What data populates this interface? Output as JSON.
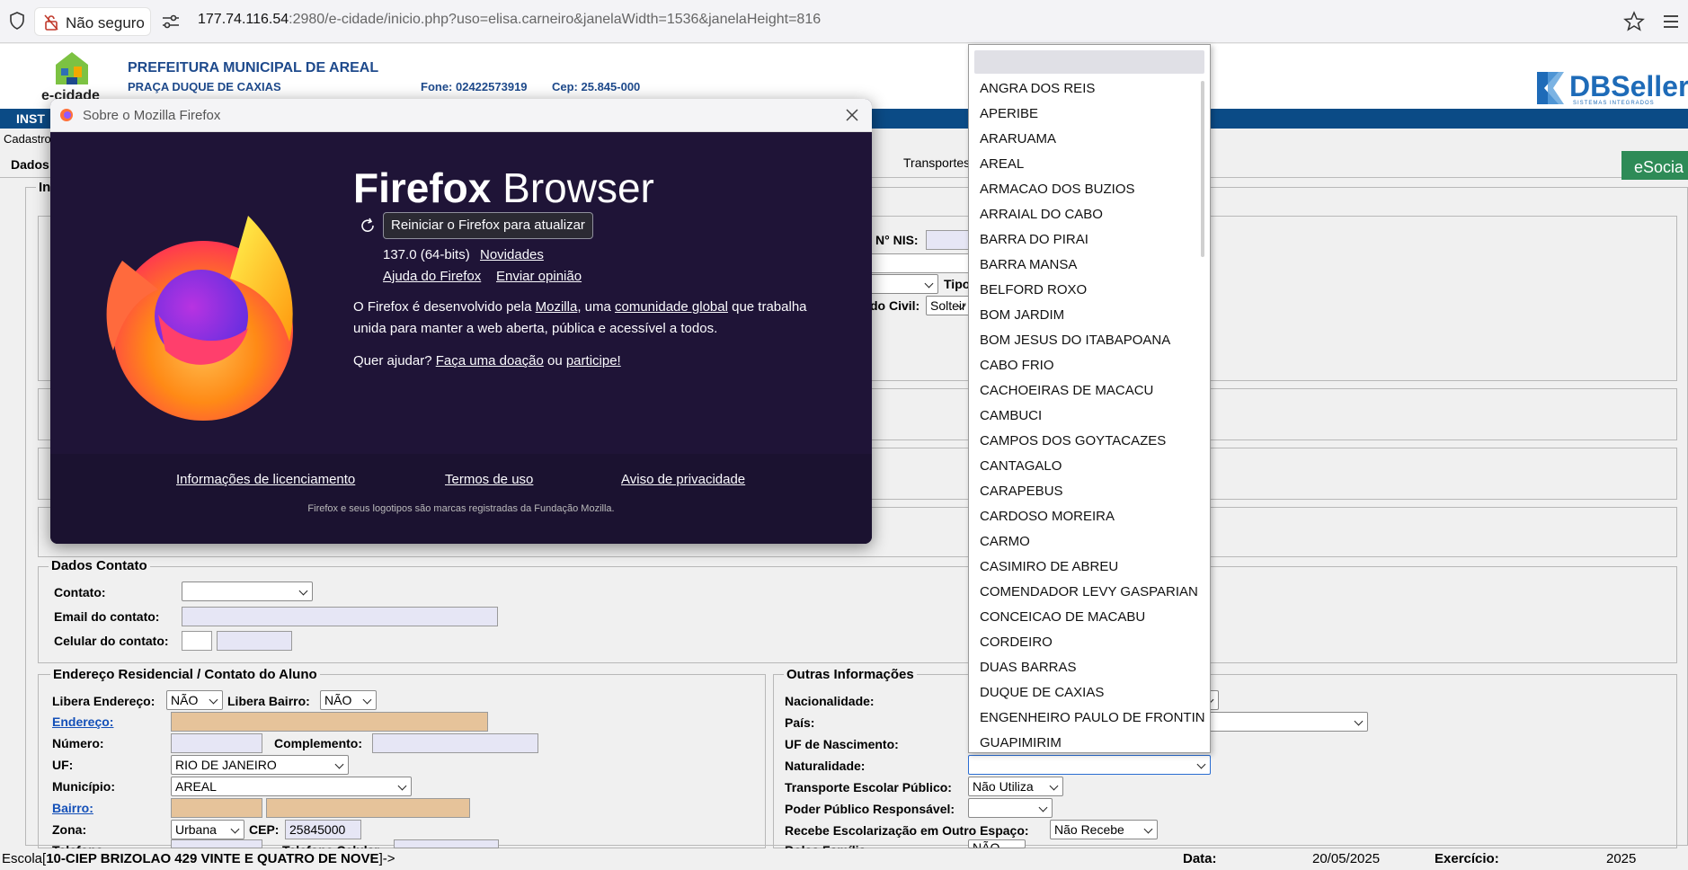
{
  "browser": {
    "security_label": "Não seguro",
    "url_host": "177.74.116.54",
    "url_rest": ":2980/e-cidade/inicio.php?uso=elisa.carneiro&janelaWidth=1536&janelaHeight=816"
  },
  "header": {
    "logo_text": "e-cidade",
    "title": "PREFEITURA MUNICIPAL DE AREAL",
    "address": "PRAÇA DUQUE DE CAXIAS",
    "phone": "Fone: 02422573919",
    "cep": "Cep: 25.845-000",
    "partner_logo": "DBSeller",
    "partner_sub": "SISTEMAS INTEGRADOS"
  },
  "nav": {
    "strip_label": "INST",
    "cadastro_label": "Cadastro",
    "tab_dados": "Dados",
    "tab_transportes": "Transportes",
    "esocial": "eSocia"
  },
  "partial_fields": {
    "section_initial": "In",
    "nis_label": "N° NIS:",
    "tipo_label": "Tipo",
    "civil_label": "do Civil:",
    "civil_value": "Solteir"
  },
  "contato": {
    "legend": "Dados Contato",
    "contato_label": "Contato:",
    "email_label": "Email do contato:",
    "celular_label": "Celular do contato:"
  },
  "endereco": {
    "legend": "Endereço Residencial / Contato do Aluno",
    "libera_endereco_label": "Libera Endereço:",
    "libera_endereco_value": "NÃO",
    "libera_bairro_label": "Libera Bairro:",
    "libera_bairro_value": "NÃO",
    "endereco_label": "Endereço:",
    "numero_label": "Número:",
    "complemento_label": "Complemento:",
    "uf_label": "UF:",
    "uf_value": "RIO DE JANEIRO",
    "municipio_label": "Município:",
    "municipio_value": "AREAL",
    "bairro_label": "Bairro:",
    "zona_label": "Zona:",
    "zona_value": "Urbana",
    "cep_label": "CEP:",
    "cep_value": "25845000",
    "telefone_label": "Telefone:",
    "telefone_celular_label": "Telefone Celular:"
  },
  "outras": {
    "legend": "Outras Informações",
    "nacionalidade_label": "Nacionalidade:",
    "pais_label": "País:",
    "uf_nasc_label": "UF de Nascimento:",
    "naturalidade_label": "Naturalidade:",
    "transporte_label": "Transporte Escolar Público:",
    "transporte_value": "Não Utiliza",
    "poder_label": "Poder Público Responsável:",
    "escolarizacao_label": "Recebe Escolarização em Outro Espaço:",
    "escolarizacao_value": "Não Recebe",
    "bolsa_label": "Bolsa Família:",
    "bolsa_value": "NÃO"
  },
  "status": {
    "escola_prefix": "Escola[",
    "escola_name": "10-CIEP BRIZOLAO 429 VINTE E QUATRO DE NOVE",
    "escola_suffix": "]->",
    "data_label": "Data:",
    "data_value": "20/05/2025",
    "exercicio_label": "Exercício:",
    "exercicio_value": "2025"
  },
  "about_dialog": {
    "title": "Sobre o Mozilla Firefox",
    "brand_bold": "Firefox",
    "brand_light": "Browser",
    "restart_button": "Reiniciar o Firefox para atualizar",
    "version": "137.0 (64-bits)",
    "whats_new": "Novidades",
    "help_link": "Ajuda do Firefox",
    "feedback_link": "Enviar opinião",
    "desc_1a": "O Firefox é desenvolvido pela ",
    "desc_mozilla": "Mozilla",
    "desc_1b": ", uma ",
    "desc_community": "comunidade global",
    "desc_1c": " que trabalha",
    "desc_2": "unida para manter a web aberta, pública e acessível a todos.",
    "help_q": "Quer ajudar? ",
    "donate_link": "Faça uma doação",
    "or_text": " ou ",
    "participate_link": "participe!",
    "licensing_link": "Informações de licenciamento",
    "terms_link": "Termos de uso",
    "privacy_link": "Aviso de privacidade",
    "trademark": "Firefox e seus logotipos são marcas registradas da Fundação Mozilla."
  },
  "naturalidade_options": [
    "ANGRA DOS REIS",
    "APERIBE",
    "ARARUAMA",
    "AREAL",
    "ARMACAO DOS BUZIOS",
    "ARRAIAL DO CABO",
    "BARRA DO PIRAI",
    "BARRA MANSA",
    "BELFORD ROXO",
    "BOM JARDIM",
    "BOM JESUS DO ITABAPOANA",
    "CABO FRIO",
    "CACHOEIRAS DE MACACU",
    "CAMBUCI",
    "CAMPOS DOS GOYTACAZES",
    "CANTAGALO",
    "CARAPEBUS",
    "CARDOSO MOREIRA",
    "CARMO",
    "CASIMIRO DE ABREU",
    "COMENDADOR LEVY GASPARIAN",
    "CONCEICAO DE MACABU",
    "CORDEIRO",
    "DUAS BARRAS",
    "DUQUE DE CAXIAS",
    "ENGENHEIRO PAULO DE FRONTIN",
    "GUAPIMIRIM"
  ],
  "colors": {
    "header_blue": "#1e4a8c",
    "nav_blue": "#0b4b86",
    "dialog_bg": "#1f1437",
    "esocial_green": "#2e8b57",
    "tan_field": "#e6c39a"
  }
}
